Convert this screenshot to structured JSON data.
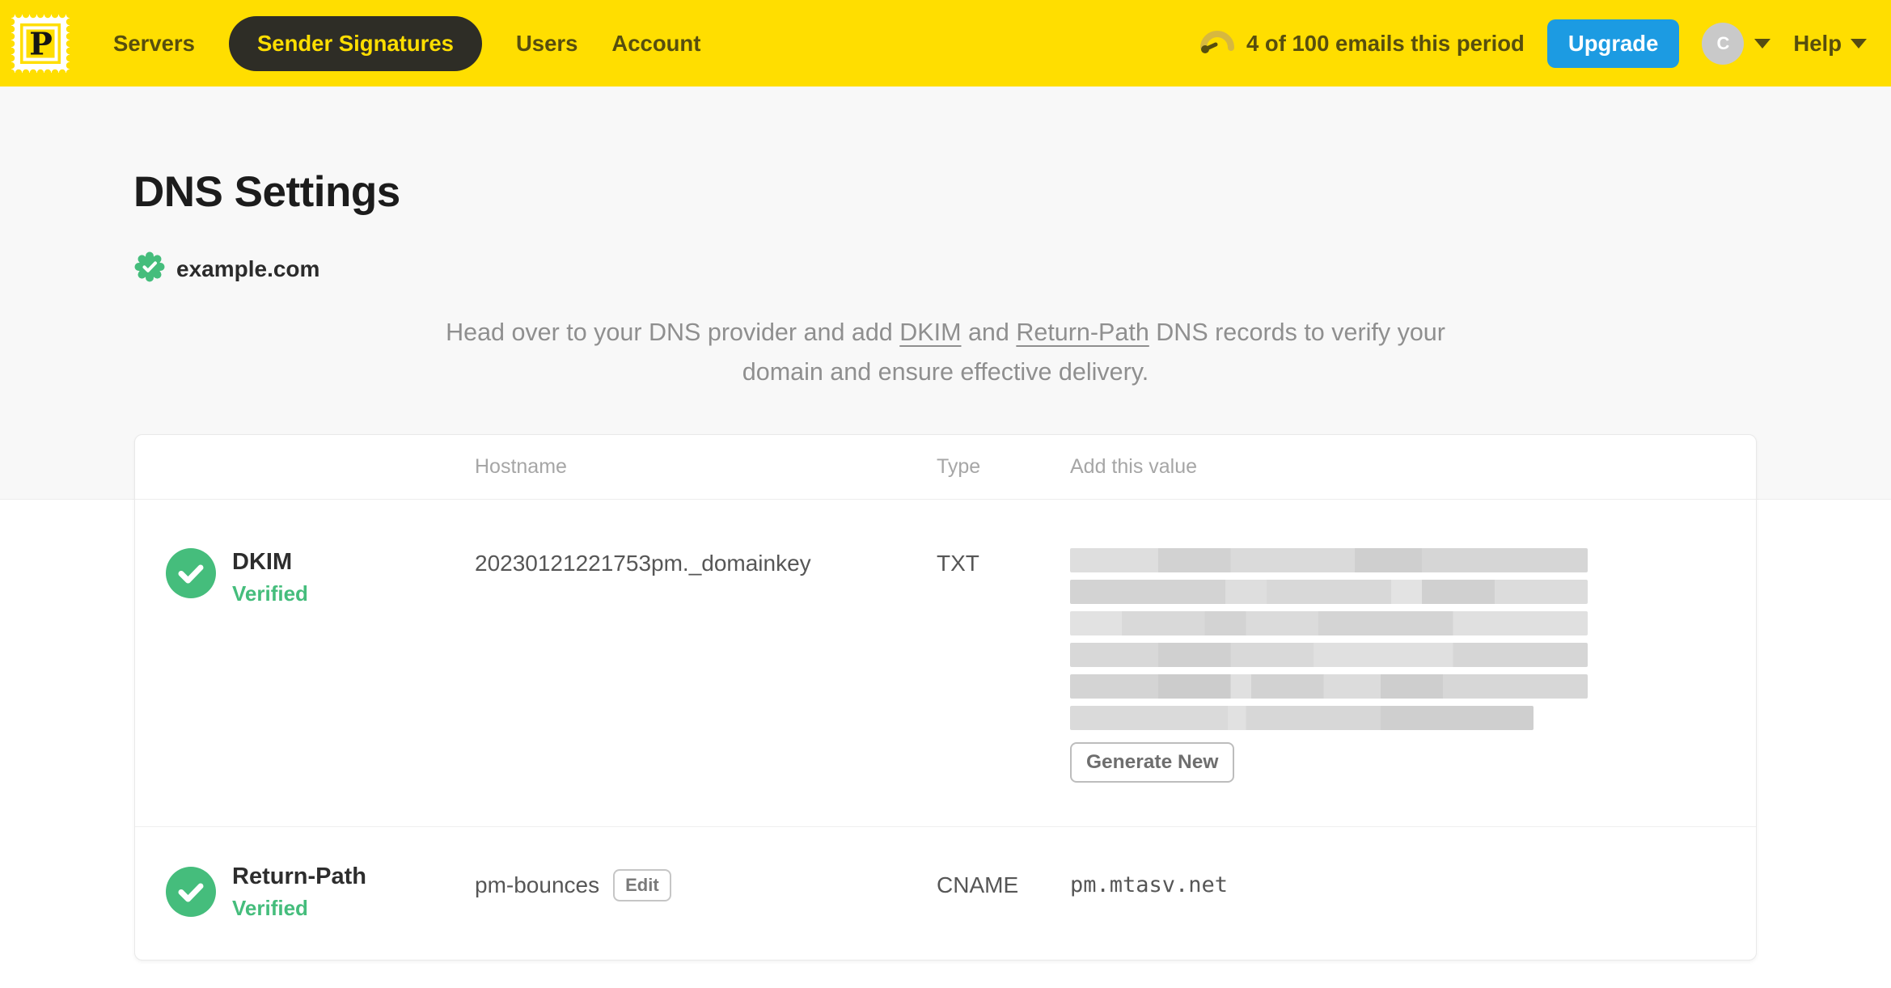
{
  "header": {
    "logo_letter": "P",
    "nav": [
      {
        "label": "Servers",
        "active": false
      },
      {
        "label": "Sender Signatures",
        "active": true
      },
      {
        "label": "Users",
        "active": false
      },
      {
        "label": "Account",
        "active": false
      }
    ],
    "usage_text": "4 of 100 emails this period",
    "upgrade_label": "Upgrade",
    "avatar_initial": "C",
    "help_label": "Help"
  },
  "page": {
    "title": "DNS Settings",
    "domain": "example.com",
    "description": {
      "prefix": "Head over to your DNS provider and add ",
      "link1": "DKIM",
      "middle": " and ",
      "link2": "Return-Path",
      "suffix": " DNS records to verify your domain and ensure effective delivery."
    }
  },
  "table": {
    "columns": [
      "Hostname",
      "Type",
      "Add this value"
    ],
    "rows": [
      {
        "name": "DKIM",
        "status": "Verified",
        "hostname": "20230121221753pm._domainkey",
        "type": "TXT",
        "value": "(redacted)",
        "action": "Generate New"
      },
      {
        "name": "Return-Path",
        "status": "Verified",
        "hostname": "pm-bounces",
        "edit_label": "Edit",
        "type": "CNAME",
        "value": "pm.mtasv.net"
      }
    ]
  },
  "colors": {
    "brand_yellow": "#ffde00",
    "nav_text": "#574e0e",
    "active_pill": "#2e2d26",
    "upgrade_blue": "#1c9be2",
    "verified_green": "#45bd7c",
    "hero_bg": "#f8f8f8"
  }
}
